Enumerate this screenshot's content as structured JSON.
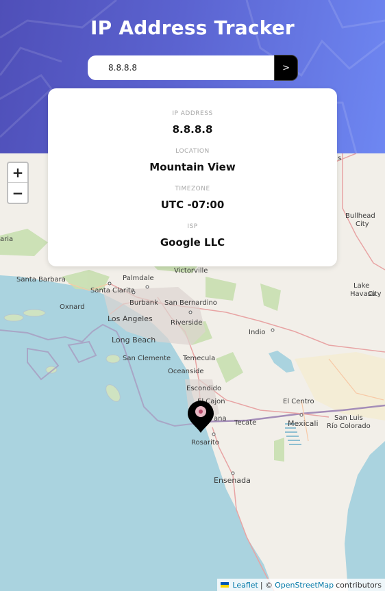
{
  "header": {
    "title": "IP Address Tracker"
  },
  "search": {
    "value": "8.8.8.8",
    "button_label": ">"
  },
  "info": {
    "ip_label": "IP ADDRESS",
    "ip_value": "8.8.8.8",
    "location_label": "LOCATION",
    "location_value": "Mountain View",
    "timezone_label": "TIMEZONE",
    "timezone_value": "UTC -07:00",
    "isp_label": "ISP",
    "isp_value": "Google LLC"
  },
  "map": {
    "zoom_in": "+",
    "zoom_out": "−",
    "places": [
      "Bullhead City",
      "Lake Havasu City",
      "Victorville",
      "Palmdale",
      "Santa Barbara",
      "Santa Clarita",
      "Oxnard",
      "Burbank",
      "San Bernardino",
      "Los Angeles",
      "Riverside",
      "Long Beach",
      "Indio",
      "San Clemente",
      "Temecula",
      "Oceanside",
      "Escondido",
      "El Cajon",
      "El Centro",
      "Tecate",
      "Mexicali",
      "San Luis Río Colorado",
      "Rosarito",
      "Ensenada"
    ],
    "partial_labels": [
      "s",
      "aria",
      "ana"
    ]
  },
  "attribution": {
    "leaflet": "Leaflet",
    "sep": "| ©",
    "osm": "OpenStreetMap",
    "contrib": "contributors"
  },
  "colors": {
    "sea": "#aad3df",
    "land": "#f2efe9",
    "header_start": "#4f4fb8",
    "header_end": "#6e87f2",
    "marker": "#000000"
  }
}
